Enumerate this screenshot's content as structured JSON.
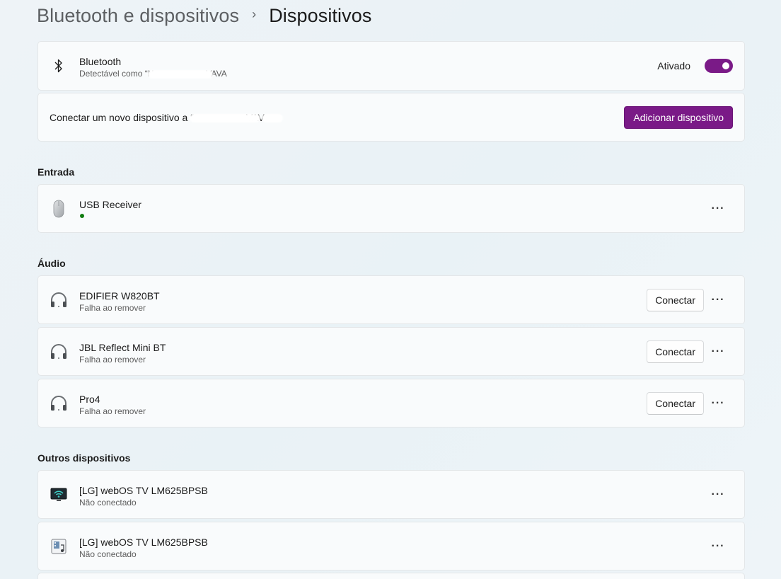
{
  "breadcrumb": {
    "parent": "Bluetooth e dispositivos",
    "separator": "›",
    "current": "Dispositivos"
  },
  "bluetooth": {
    "title": "Bluetooth",
    "subtitle_prefix": "Detectável como “N",
    "subtitle_suffix": "VAVA",
    "state_label": "Ativado",
    "toggle_on": true
  },
  "add_device": {
    "text_prefix": "Conectar um novo dispositivo a “",
    "text_suffix": "VAV",
    "button_label": "Adicionar dispositivo"
  },
  "sections": {
    "input": {
      "label": "Entrada",
      "devices": [
        {
          "name": "USB Receiver",
          "icon": "mouse-icon",
          "status_color": "#107c10"
        }
      ]
    },
    "audio": {
      "label": "Áudio",
      "devices": [
        {
          "name": "EDIFIER W820BT",
          "status": "Falha ao remover",
          "button": "Conectar",
          "icon": "headphones-icon"
        },
        {
          "name": "JBL Reflect Mini BT",
          "status": "Falha ao remover",
          "button": "Conectar",
          "icon": "headphones-icon"
        },
        {
          "name": "Pro4",
          "status": "Falha ao remover",
          "button": "Conectar",
          "icon": "headphones-icon"
        }
      ]
    },
    "other": {
      "label": "Outros dispositivos",
      "devices": [
        {
          "name": "[LG] webOS TV LM625BPSB",
          "status": "Não conectado",
          "icon": "wireless-display-icon"
        },
        {
          "name": "[LG] webOS TV LM625BPSB",
          "status": "Não conectado",
          "icon": "media-device-icon"
        }
      ]
    }
  },
  "more_label": "···",
  "colors": {
    "accent": "#7a1a87",
    "status_ok": "#107c10"
  }
}
